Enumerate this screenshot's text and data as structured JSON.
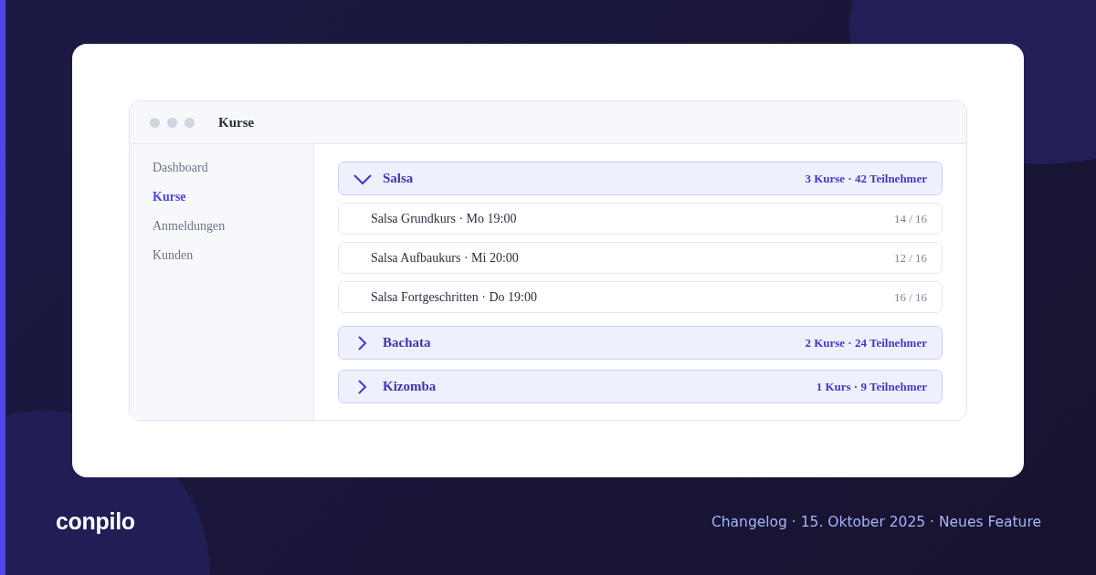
{
  "window": {
    "title": "Kurse"
  },
  "sidebar": {
    "items": [
      {
        "label": "Dashboard",
        "selected": false
      },
      {
        "label": "Kurse",
        "selected": true
      },
      {
        "label": "Anmeldungen",
        "selected": false
      },
      {
        "label": "Kunden",
        "selected": false
      }
    ]
  },
  "groups": [
    {
      "name": "Salsa",
      "summary": "3 Kurse · 42 Teilnehmer",
      "expanded": true,
      "courses": [
        {
          "title": "Salsa Grundkurs · Mo 19:00",
          "occupancy": "14 / 16"
        },
        {
          "title": "Salsa Aufbaukurs · Mi 20:00",
          "occupancy": "12 / 16"
        },
        {
          "title": "Salsa Fortgeschritten · Do 19:00",
          "occupancy": "16 / 16"
        }
      ]
    },
    {
      "name": "Bachata",
      "summary": "2 Kurse · 24 Teilnehmer",
      "expanded": false
    },
    {
      "name": "Kizomba",
      "summary": "1 Kurs · 9 Teilnehmer",
      "expanded": false
    }
  ],
  "footer": {
    "logo": "conpilo",
    "caption": "Changelog · 15. Oktober 2025 · Neues Feature"
  }
}
